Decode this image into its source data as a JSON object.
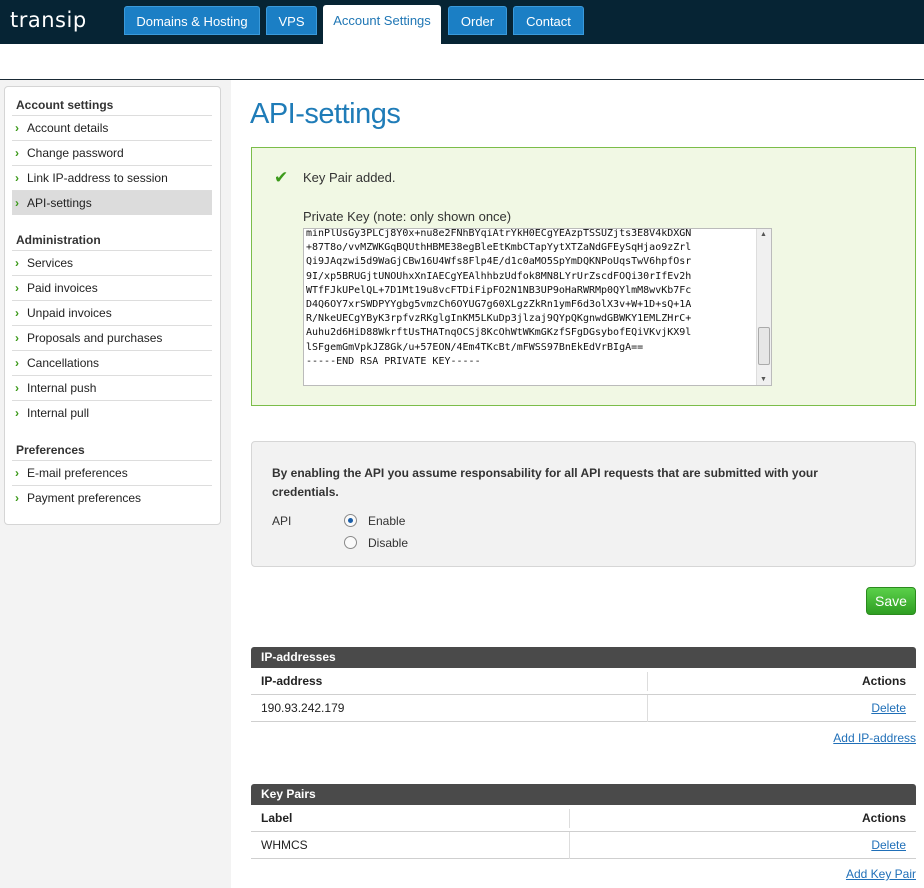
{
  "brand": {
    "part1": "trans",
    "part2": "ip"
  },
  "nav": {
    "tabs": [
      {
        "label": "Domains & Hosting"
      },
      {
        "label": "VPS"
      },
      {
        "label": "Account Settings"
      },
      {
        "label": "Order"
      },
      {
        "label": "Contact"
      }
    ]
  },
  "sidebar": {
    "sections": [
      {
        "heading": "Account settings",
        "items": [
          "Account details",
          "Change password",
          "Link IP-address to session",
          "API-settings"
        ]
      },
      {
        "heading": "Administration",
        "items": [
          "Services",
          "Paid invoices",
          "Unpaid invoices",
          "Proposals and purchases",
          "Cancellations",
          "Internal push",
          "Internal pull"
        ]
      },
      {
        "heading": "Preferences",
        "items": [
          "E-mail preferences",
          "Payment preferences"
        ]
      }
    ]
  },
  "page": {
    "title": "API-settings"
  },
  "success": {
    "message": "Key Pair added.",
    "private_key_label": "Private Key (note: only shown once)",
    "private_key": "minPlUsGy3PLCj8Y0x+nu8e2FNhBYqiAtrYkH0ECgYEAzpTSSUZjts3E8V4kDXGN\n+87T8o/vvMZWKGqBQUthHBME38egBleEtKmbCTapYytXTZaNdGFEySqHjao9zZrl\nQi9JAqzwi5d9WaGjCBw16U4Wfs8Flp4E/d1c0aMO5SpYmDQKNPoUqsTwV6hpfOsr\n9I/xp5BRUGjtUNOUhxXnIAECgYEAlhhbzUdfok8MN8LYrUrZscdFOQi30rIfEv2h\nWTfFJkUPelQL+7D1Mt19u8vcFTDiFipFO2N1NB3UP9oHaRWRMp0QYlmM8wvKb7Fc\nD4Q6OY7xrSWDPYYgbg5vmzCh6OYUG7g60XLgzZkRn1ymF6d3olX3v+W+1D+sQ+1A\nR/NkeUECgYByK3rpfvzRKglgInKM5LKuDp3jlzaj9QYpQKgnwdGBWKY1EMLZHrC+\nAuhu2d6HiD88WkrftUsTHATnqOCSj8KcOhWtWKmGKzfSFgDGsybofEQiVKvjKX9l\nlSFgemGmVpkJZ8Gk/u+57EON/4Em4TKcBt/mFWSS97BnEkEdVrBIgA==\n-----END RSA PRIVATE KEY-----"
  },
  "api": {
    "notice": "By enabling the API you assume responsability for all API requests that are submitted with your credentials.",
    "label": "API",
    "options": [
      "Enable",
      "Disable"
    ],
    "selected": "Enable"
  },
  "save_label": "Save",
  "ip_panel": {
    "title": "IP-addresses",
    "columns": [
      "IP-address",
      "Actions"
    ],
    "rows": [
      {
        "value": "190.93.242.179",
        "action": "Delete"
      }
    ],
    "add_label": "Add IP-address"
  },
  "key_panel": {
    "title": "Key Pairs",
    "columns": [
      "Label",
      "Actions"
    ],
    "rows": [
      {
        "value": "WHMCS",
        "action": "Delete"
      }
    ],
    "add_label": "Add Key Pair"
  },
  "colors": {
    "accent": "#1f7cb8",
    "topbar": "#062434",
    "success": "#3c9a1a",
    "save": "#3aae2c"
  }
}
